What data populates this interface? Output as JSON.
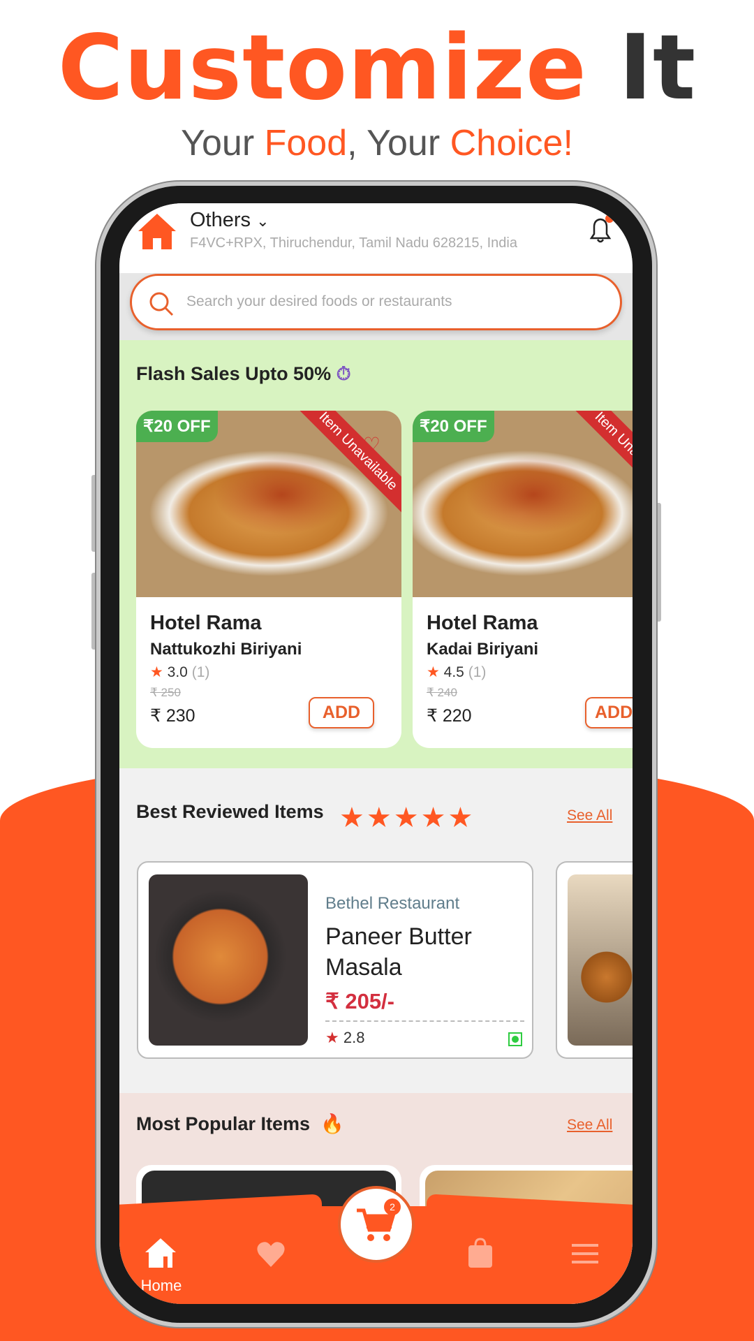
{
  "hero": {
    "title_a": "Customize",
    "title_b": "It",
    "subtitle_1": "Your ",
    "subtitle_2": "Food",
    "subtitle_3": ", Your ",
    "subtitle_4": "Choice!"
  },
  "header": {
    "location_label": "Others",
    "address": "F4VC+RPX, Thiruchendur, Tamil Nadu 628215, India"
  },
  "search": {
    "placeholder": "Search your desired foods or restaurants"
  },
  "flash": {
    "title": "Flash Sales Upto 50%",
    "items": [
      {
        "discount": "₹20 OFF",
        "ribbon": "Item Unavailable",
        "restaurant": "Hotel Rama",
        "name": "Nattukozhi Biriyani",
        "rating": "3.0",
        "count": "(1)",
        "old_price": "₹ 250",
        "price": "₹ 230",
        "add": "ADD"
      },
      {
        "discount": "₹20 OFF",
        "ribbon": "Item Unavailable",
        "restaurant": "Hotel Rama",
        "name": "Kadai Biriyani",
        "rating": "4.5",
        "count": "(1)",
        "old_price": "₹ 240",
        "price": "₹ 220",
        "add": "ADD"
      }
    ]
  },
  "reviewed": {
    "title": "Best Reviewed Items",
    "stars": 5,
    "see_all": "See All",
    "items": [
      {
        "restaurant": "Bethel Restaurant",
        "name": "Paneer Butter Masala",
        "price": "₹ 205/-",
        "rating": "2.8",
        "veg": true
      }
    ]
  },
  "popular": {
    "title": "Most Popular Items",
    "see_all": "See All"
  },
  "nav": {
    "home": "Home",
    "cart_count": "2"
  },
  "colors": {
    "accent": "#ff5722",
    "flash_bg": "#d8f3c1",
    "popular_bg": "#f2e2de",
    "veg": "#2ecc40"
  }
}
